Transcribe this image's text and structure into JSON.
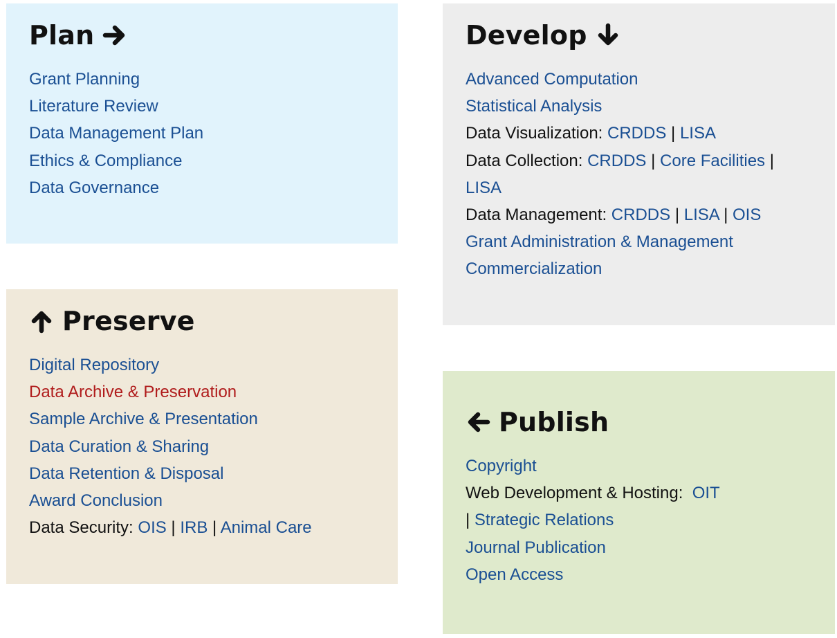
{
  "colors": {
    "link": "#1a4f93",
    "active_link": "#b01c1c",
    "text": "#111111",
    "plan_bg": "#e1f3fc",
    "develop_bg": "#ededed",
    "preserve_bg": "#f0e9da",
    "publish_bg": "#dfeacc"
  },
  "plan": {
    "title": "Plan",
    "icon": "arrow-right-icon",
    "items": [
      "Grant Planning",
      "Literature Review",
      "Data Management Plan",
      "Ethics & Compliance",
      "Data Governance"
    ]
  },
  "develop": {
    "title": "Develop",
    "icon": "arrow-down-icon",
    "items": {
      "advanced_computation": "Advanced Computation",
      "statistical_analysis": "Statistical Analysis",
      "data_visualization": {
        "label": "Data Visualization: ",
        "links": [
          "CRDDS",
          "LISA"
        ]
      },
      "data_collection": {
        "label": "Data Collection: ",
        "links": [
          "CRDDS",
          "Core Facilities",
          "LISA"
        ]
      },
      "data_management": {
        "label": "Data Management: ",
        "links": [
          "CRDDS",
          "LISA",
          "OIS"
        ]
      },
      "grant_admin": "Grant Administration & Management",
      "commercialization": "Commercialization"
    },
    "separator": "|"
  },
  "preserve": {
    "title": "Preserve",
    "icon": "arrow-up-icon",
    "items": [
      "Digital Repository",
      "Data Archive & Preservation",
      "Sample Archive & Presentation",
      "Data Curation & Sharing",
      "Data Retention & Disposal",
      "Award Conclusion"
    ],
    "active_item": "Data Archive & Preservation",
    "data_security": {
      "label": "Data Security: ",
      "links": [
        "OIS",
        "IRB",
        "Animal Care"
      ]
    },
    "separator": "|"
  },
  "publish": {
    "title": "Publish",
    "icon": "arrow-left-icon",
    "copyright": "Copyright",
    "web_dev": {
      "label": "Web Development & Hosting:  ",
      "links": [
        "OIT",
        "Strategic Relations"
      ]
    },
    "journal_publication": "Journal Publication",
    "open_access": "Open Access",
    "separator": "|"
  }
}
